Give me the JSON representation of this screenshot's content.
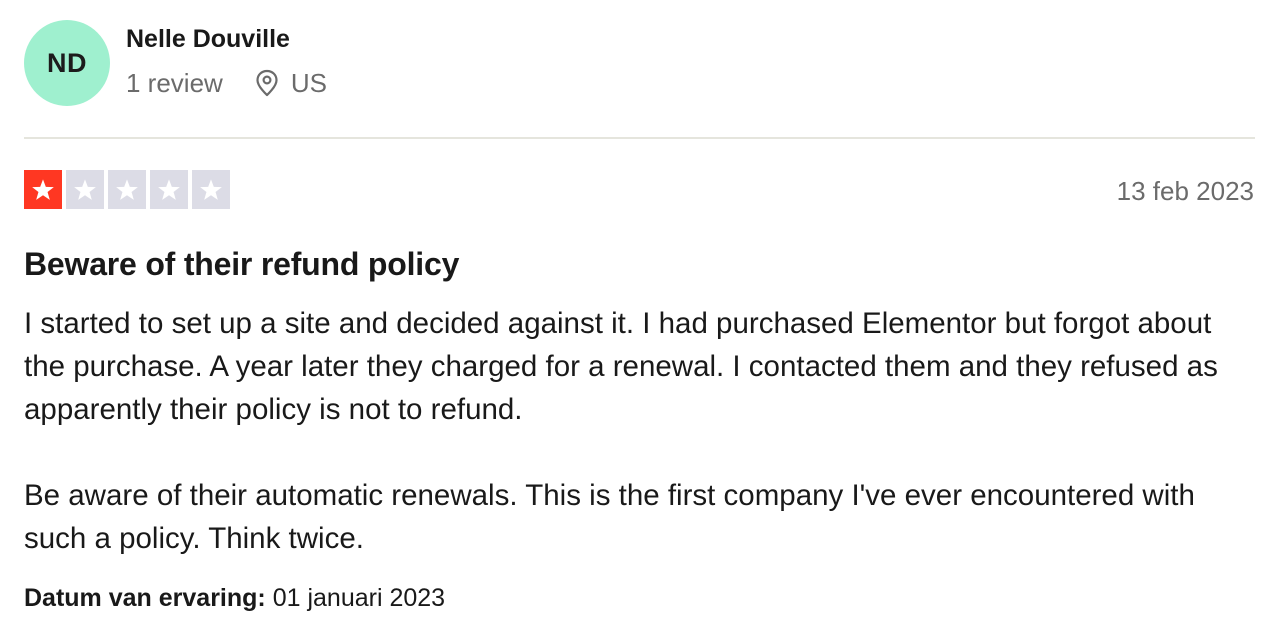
{
  "reviewer": {
    "initials": "ND",
    "name": "Nelle Douville",
    "review_count": "1 review",
    "location": "US",
    "avatar_color": "#9ff0cf",
    "location_icon": "map-pin-icon"
  },
  "review": {
    "rating": 1,
    "rating_max": 5,
    "star_color_filled": "#ff3722",
    "star_color_empty": "#dcdce6",
    "date": "13 feb 2023",
    "title": "Beware of their refund policy",
    "paragraphs": [
      "I started to set up a site and decided against it. I had purchased Elementor but forgot about the purchase. A year later they charged for a renewal. I contacted them and they refused as apparently their policy is not to refund.",
      "Be aware of their automatic renewals. This is the first company I've ever encountered with such a policy. Think twice."
    ],
    "experience_label": "Datum van ervaring:",
    "experience_date": "01 januari 2023"
  }
}
